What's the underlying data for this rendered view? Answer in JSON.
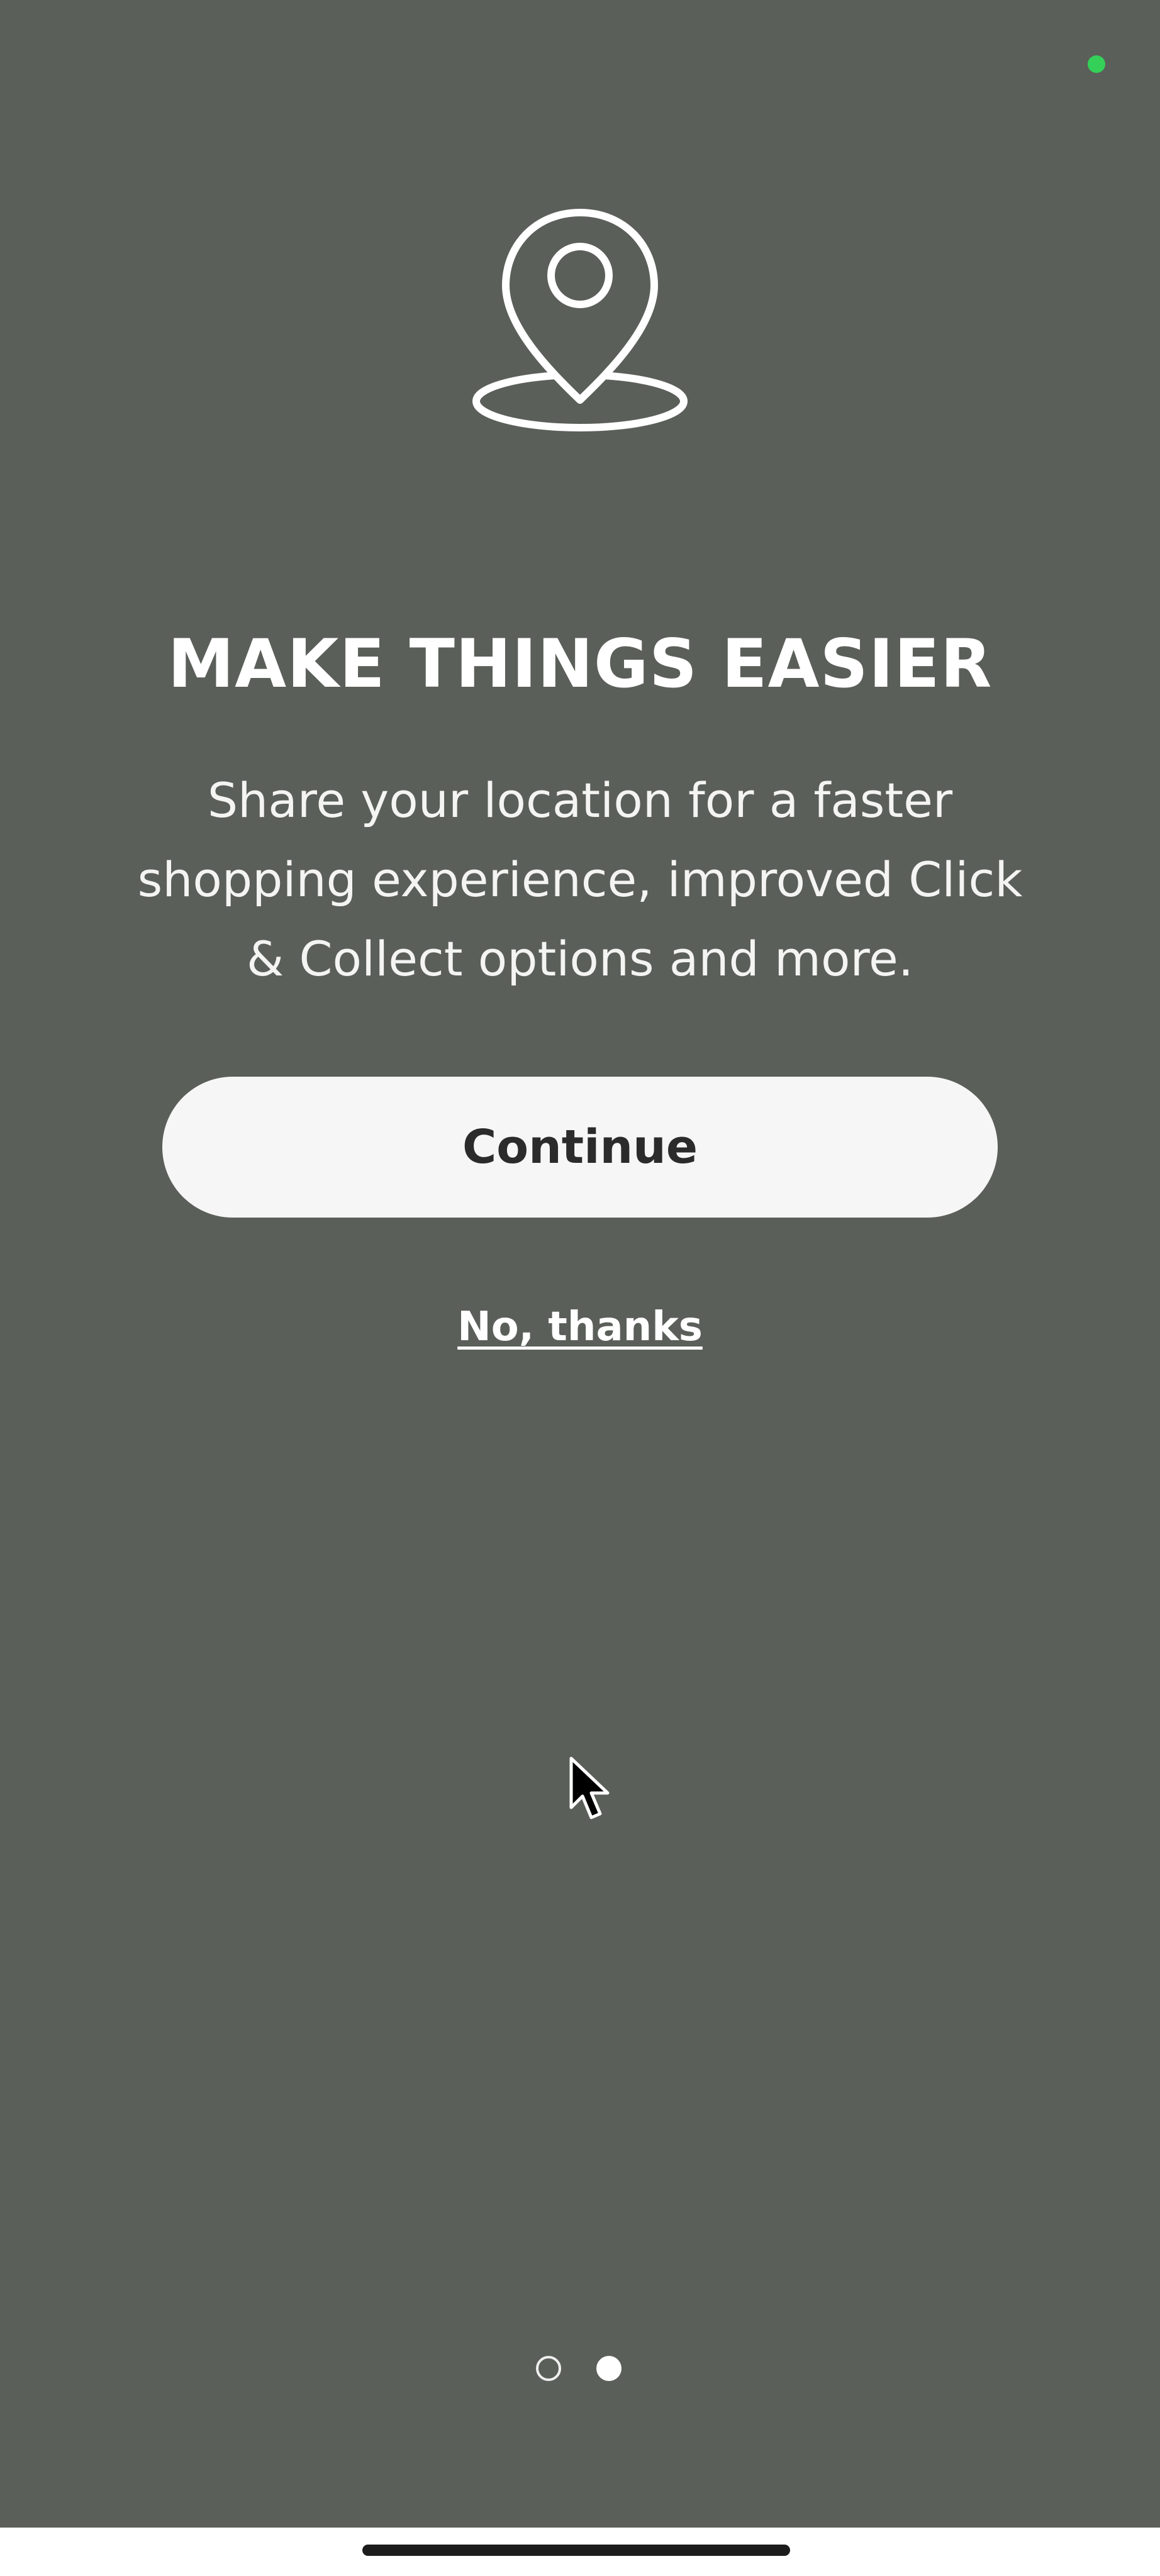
{
  "theme": {
    "background": "#5b5f59",
    "status_dot_color": "#34d058",
    "button_background": "#f6f6f6",
    "button_text": "#2b2b2b",
    "text_color": "#ffffff"
  },
  "hero": {
    "icon": "map-pin-icon"
  },
  "content": {
    "title": "MAKE THINGS EASIER",
    "description": "Share your location for a faster shopping experience, improved Click & Collect options and more."
  },
  "actions": {
    "continue_label": "Continue",
    "decline_label": "No, thanks"
  },
  "pagination": {
    "total_pages": 2,
    "current_page": 2
  },
  "cursor": {
    "icon": "mouse-pointer-icon"
  }
}
